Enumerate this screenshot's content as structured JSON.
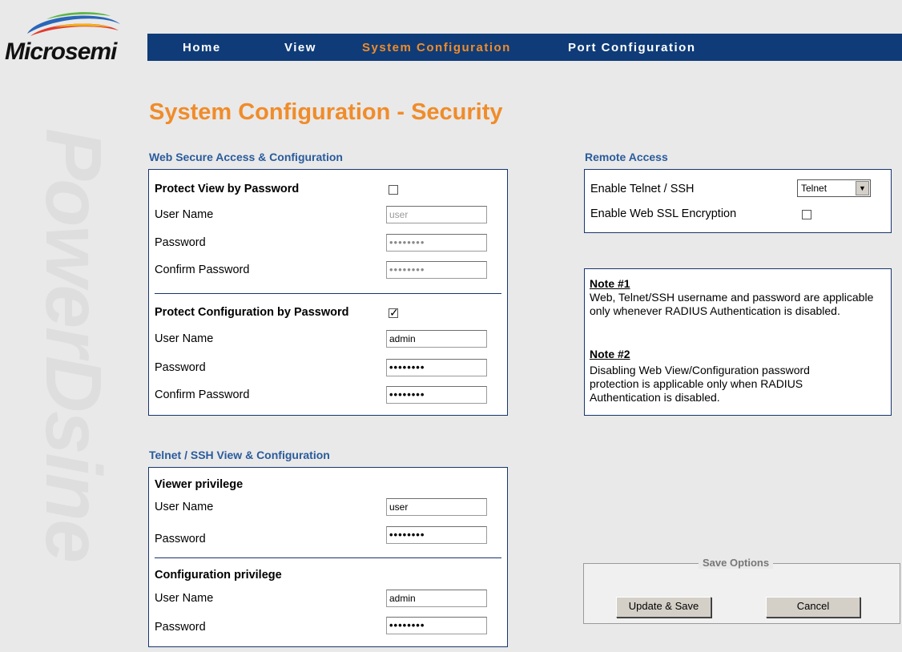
{
  "brand": {
    "logo_text": "Microsemi",
    "watermark_text": "PowerDsine"
  },
  "nav": {
    "items": [
      "Home",
      "View",
      "System Configuration",
      "Port Configuration"
    ],
    "active": "System Configuration"
  },
  "page": {
    "title": "System Configuration - Security"
  },
  "web_access": {
    "title": "Web Secure Access & Configuration",
    "view": {
      "heading": "Protect View by Password",
      "checked": false,
      "username_label": "User Name",
      "username_value": "user",
      "password_label": "Password",
      "password_mask": "••••••••",
      "confirm_label": "Confirm Password",
      "confirm_mask": "••••••••"
    },
    "config": {
      "heading": "Protect Configuration by Password",
      "checked": true,
      "username_label": "User Name",
      "username_value": "admin",
      "password_label": "Password",
      "password_mask": "••••••••",
      "confirm_label": "Confirm Password",
      "confirm_mask": "••••••••"
    }
  },
  "telnet": {
    "title": "Telnet / SSH View & Configuration",
    "viewer": {
      "heading": "Viewer privilege",
      "username_label": "User Name",
      "username_value": "user",
      "password_label": "Password",
      "password_mask": "••••••••"
    },
    "config": {
      "heading": "Configuration privilege",
      "username_label": "User Name",
      "username_value": "admin",
      "password_label": "Password",
      "password_mask": "••••••••"
    }
  },
  "remote": {
    "title": "Remote Access",
    "telnet_label": "Enable Telnet / SSH",
    "telnet_value": "Telnet",
    "ssl_label": "Enable Web SSL Encryption",
    "ssl_checked": false
  },
  "notes": {
    "note1_title": "Note #1",
    "note1_text": "Web, Telnet/SSH username and password are applicable only whenever RADIUS Authentication is disabled.",
    "note2_title": "Note #2",
    "note2_text": "Disabling Web View/Configuration password protection is applicable only when RADIUS Authentication is disabled."
  },
  "save": {
    "legend": "Save Options",
    "update_label": "Update & Save",
    "cancel_label": "Cancel"
  },
  "colors": {
    "nav_bg": "#0f3c78",
    "accent": "#f08c2a",
    "section_blue": "#2a5b9c"
  }
}
